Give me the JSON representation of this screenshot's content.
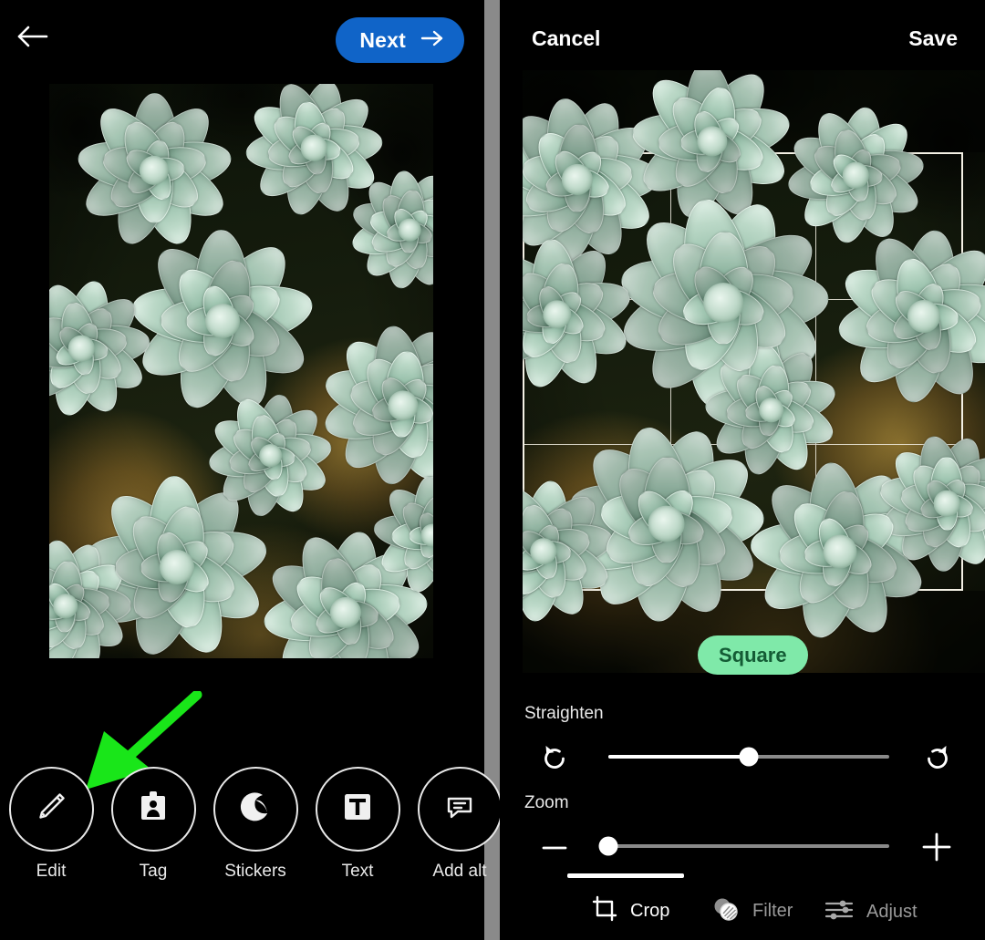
{
  "app": {
    "theme": "dark",
    "background_color": "#000000",
    "divider_color": "#8a8a8a"
  },
  "left_panel": {
    "header": {
      "back_icon": "back-arrow-icon",
      "next_button": {
        "label": "Next",
        "icon": "arrow-right-icon",
        "background_color": "#1064c8",
        "text_color": "#ffffff"
      }
    },
    "photo": {
      "alt": "Close-up of pale green succulent rosettes",
      "aspect": "portrait"
    },
    "annotation": {
      "type": "arrow",
      "color": "#19e619",
      "points_to": "Edit"
    },
    "tools": [
      {
        "label": "Edit",
        "icon": "pencil-icon"
      },
      {
        "label": "Tag",
        "icon": "tag-person-icon"
      },
      {
        "label": "Stickers",
        "icon": "sticker-moon-icon"
      },
      {
        "label": "Text",
        "icon": "text-t-icon"
      },
      {
        "label": "Add alt",
        "icon": "alt-text-icon"
      }
    ]
  },
  "right_panel": {
    "header": {
      "cancel_label": "Cancel",
      "save_label": "Save"
    },
    "photo": {
      "alt": "Close-up of pale green succulent rosettes"
    },
    "crop": {
      "grid": "rule-of-thirds",
      "frame_color": "#f3f0e4",
      "aspect_chip": {
        "label": "Square",
        "background_color": "#7fe9a9",
        "text_color": "#145c35",
        "selected": true
      }
    },
    "straighten": {
      "label": "Straighten",
      "rotate_left_icon": "rotate-counterclockwise-icon",
      "rotate_right_icon": "rotate-clockwise-icon",
      "value_percent": 50
    },
    "zoom": {
      "label": "Zoom",
      "minus_icon": "minus-icon",
      "plus_icon": "plus-icon",
      "value_percent": 0
    },
    "tabs": [
      {
        "label": "Crop",
        "icon": "crop-icon",
        "active": true
      },
      {
        "label": "Filter",
        "icon": "filter-icon",
        "active": false
      },
      {
        "label": "Adjust",
        "icon": "adjust-sliders-icon",
        "active": false
      }
    ]
  }
}
